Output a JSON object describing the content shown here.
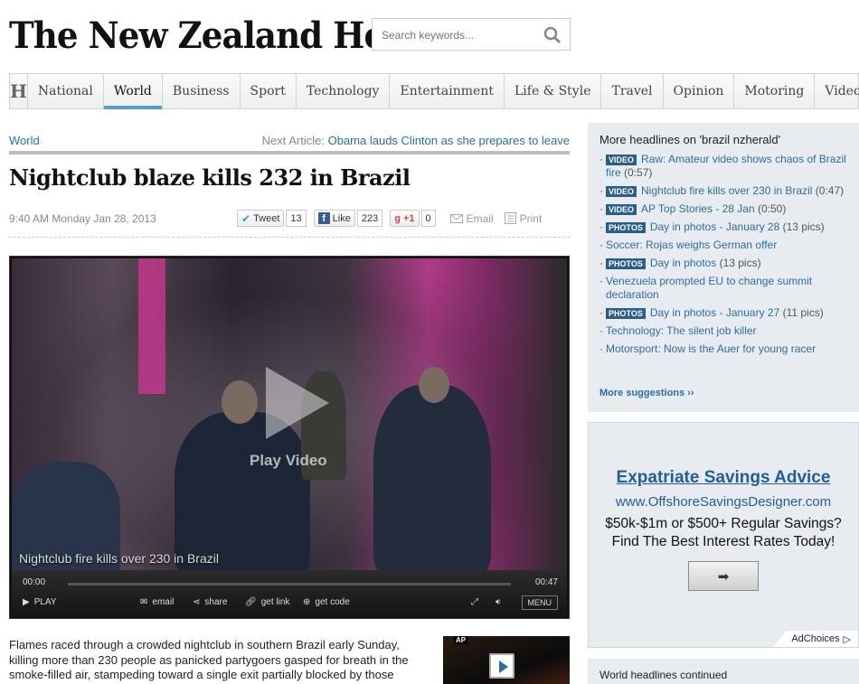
{
  "masthead": {
    "title": "The New Zealand Herald"
  },
  "search": {
    "placeholder": "Search keywords..."
  },
  "nav": {
    "home_glyph": "H",
    "items": [
      "National",
      "World",
      "Business",
      "Sport",
      "Technology",
      "Entertainment",
      "Life & Style",
      "Travel",
      "Opinion",
      "Motoring",
      "Video"
    ],
    "active": "World"
  },
  "article": {
    "section": "World",
    "next_label": "Next Article:",
    "next_title": "Obama lauds Clinton as she prepares to leave",
    "headline": "Nightclub blaze kills 232 in Brazil",
    "dateline": "9:40 AM Monday Jan 28, 2013",
    "share": {
      "tweet_label": "Tweet",
      "tweet_count": "13",
      "like_label": "Like",
      "like_count": "223",
      "gplus_label": "+1",
      "gplus_count": "0",
      "email_label": "Email",
      "print_label": "Print"
    },
    "body_lines": [
      "Flames raced through a crowded nightclub in southern Brazil early Sunday,",
      "killing more than 230 people as panicked partygoers gasped for breath in the",
      "smoke-filled air, stampeding toward a single exit partially blocked by those"
    ],
    "thumb_badge": "AP"
  },
  "video": {
    "play_label": "Play Video",
    "caption": "Nightclub fire kills over 230 in Brazil",
    "time_current": "00:00",
    "time_total": "00:47",
    "controls": {
      "play": "PLAY",
      "email": "email",
      "share": "share",
      "get_link": "get link",
      "get_code": "get code",
      "menu": "MENU"
    }
  },
  "sidebar": {
    "title": "More headlines on 'brazil nzherald'",
    "items": [
      {
        "tag": "VIDEO",
        "text": "Raw: Amateur video shows chaos of Brazil fire",
        "meta": "(0:57)"
      },
      {
        "tag": "VIDEO",
        "text": "Nightclub fire kills over 230 in Brazil",
        "meta": "(0:47)"
      },
      {
        "tag": "VIDEO",
        "text": "AP Top Stories - 28 Jan",
        "meta": "(0:50)"
      },
      {
        "tag": "PHOTOS",
        "text": "Day in photos - January 28",
        "meta": "(13 pics)"
      },
      {
        "tag": "",
        "text": "Soccer: Rojas weighs German offer",
        "meta": ""
      },
      {
        "tag": "PHOTOS",
        "text": "Day in photos",
        "meta": "(13 pics)"
      },
      {
        "tag": "",
        "text": "Venezuela prompted EU to change summit declaration",
        "meta": ""
      },
      {
        "tag": "PHOTOS",
        "text": "Day in photos - January 27",
        "meta": "(11 pics)"
      },
      {
        "tag": "",
        "text": "Technology: The silent job killer",
        "meta": ""
      },
      {
        "tag": "",
        "text": "Motorsport: Now is the Auer for young racer",
        "meta": ""
      }
    ],
    "more_suggestions": "More suggestions ››"
  },
  "ad": {
    "title": "Expatriate Savings Advice",
    "url": "www.OffshoreSavingsDesigner.com",
    "line1": "$50k-$1m or $500+ Regular Savings?",
    "line2": "Find The Best Interest Rates Today!",
    "button": "➡",
    "adchoices": "AdChoices"
  },
  "world_box": {
    "title": "World headlines continued"
  },
  "colors": {
    "link": "#2a6ea3",
    "nav_active": "#4ea0cf",
    "tag_bg": "#2a5f8c",
    "sidebar_bg": "#e8ecf0"
  }
}
